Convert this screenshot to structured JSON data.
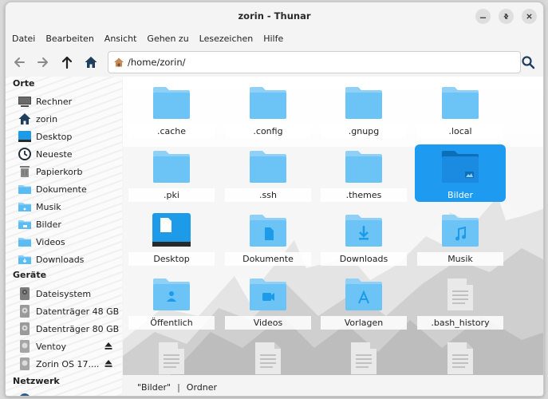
{
  "window": {
    "title": "zorin - Thunar"
  },
  "menubar": [
    "Datei",
    "Bearbeiten",
    "Ansicht",
    "Gehen zu",
    "Lesezeichen",
    "Hilfe"
  ],
  "location": {
    "path": "/home/zorin/"
  },
  "sidebar": {
    "sections": [
      {
        "heading": "Orte"
      },
      {
        "heading": "Geräte"
      },
      {
        "heading": "Netzwerk"
      }
    ],
    "places": [
      {
        "label": "Rechner",
        "icon": "computer-icon"
      },
      {
        "label": "zorin",
        "icon": "home-icon"
      },
      {
        "label": "Desktop",
        "icon": "desktop-icon"
      },
      {
        "label": "Neueste",
        "icon": "clock-icon"
      },
      {
        "label": "Papierkorb",
        "icon": "trash-icon"
      },
      {
        "label": "Dokumente",
        "icon": "folder-icon"
      },
      {
        "label": "Musik",
        "icon": "folder-music-icon"
      },
      {
        "label": "Bilder",
        "icon": "folder-pictures-icon"
      },
      {
        "label": "Videos",
        "icon": "folder-videos-icon"
      },
      {
        "label": "Downloads",
        "icon": "folder-downloads-icon"
      }
    ],
    "devices": [
      {
        "label": "Dateisystem",
        "icon": "drive-icon"
      },
      {
        "label": "Datenträger 48 GB",
        "icon": "disk-icon"
      },
      {
        "label": "Datenträger 80 GB",
        "icon": "disk-icon"
      },
      {
        "label": "Ventoy",
        "icon": "removable-drive-icon",
        "eject": true
      },
      {
        "label": "Zorin OS 17....",
        "icon": "removable-drive-icon",
        "eject": true
      }
    ]
  },
  "files": [
    {
      "name": ".cache",
      "type": "folder"
    },
    {
      "name": ".config",
      "type": "folder"
    },
    {
      "name": ".gnupg",
      "type": "folder"
    },
    {
      "name": ".local",
      "type": "folder"
    },
    {
      "name": ".pki",
      "type": "folder"
    },
    {
      "name": ".ssh",
      "type": "folder"
    },
    {
      "name": ".themes",
      "type": "folder"
    },
    {
      "name": "Bilder",
      "type": "folder-pictures",
      "selected": true
    },
    {
      "name": "Desktop",
      "type": "desktop"
    },
    {
      "name": "Dokumente",
      "type": "folder-documents"
    },
    {
      "name": "Downloads",
      "type": "folder-downloads"
    },
    {
      "name": "Musik",
      "type": "folder-music"
    },
    {
      "name": "Öffentlich",
      "type": "folder-public"
    },
    {
      "name": "Videos",
      "type": "folder-videos"
    },
    {
      "name": "Vorlagen",
      "type": "folder-templates"
    },
    {
      "name": ".bash_history",
      "type": "text-file"
    },
    {
      "name": "",
      "type": "text-file"
    },
    {
      "name": "",
      "type": "text-file"
    },
    {
      "name": "",
      "type": "text-file"
    },
    {
      "name": "",
      "type": "text-file"
    }
  ],
  "statusbar": {
    "selection": "\"Bilder\"",
    "separator": "|",
    "kind": "Ordner"
  },
  "colors": {
    "accent": "#1e9bf0",
    "folder": "#8fd0f7",
    "folder_dark": "#4bb3f0"
  }
}
